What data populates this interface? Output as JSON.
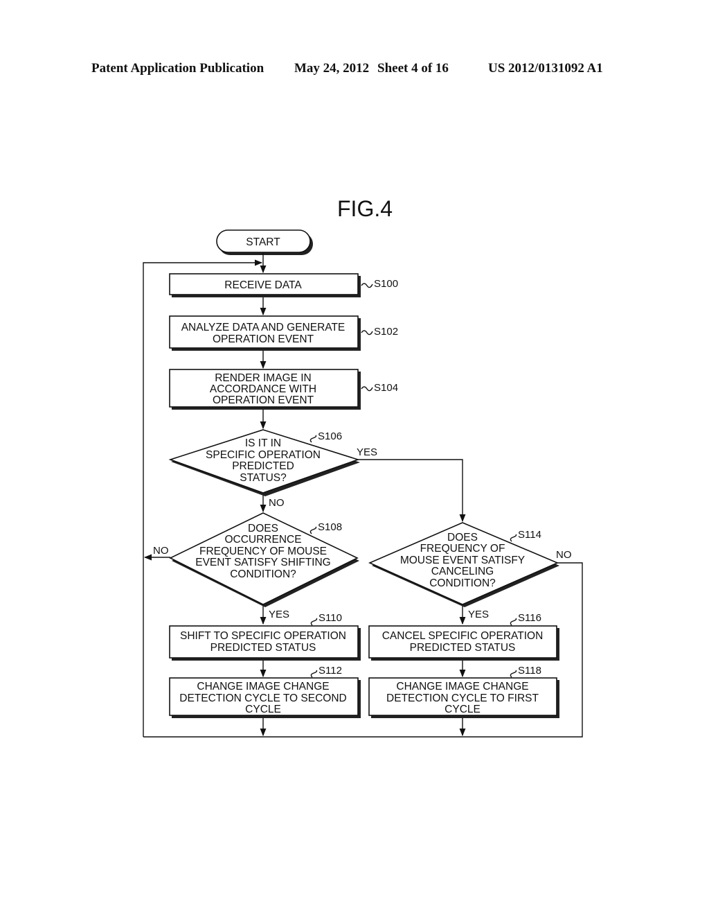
{
  "header": {
    "publication": "Patent Application Publication",
    "date": "May 24, 2012",
    "sheet": "Sheet 4 of 16",
    "number": "US 2012/0131092 A1"
  },
  "figure": {
    "title": "FIG.4",
    "start": "START",
    "steps": {
      "s100": {
        "id": "S100",
        "lines": [
          "RECEIVE DATA"
        ]
      },
      "s102": {
        "id": "S102",
        "lines": [
          "ANALYZE DATA AND GENERATE",
          "OPERATION EVENT"
        ]
      },
      "s104": {
        "id": "S104",
        "lines": [
          "RENDER IMAGE IN",
          "ACCORDANCE WITH",
          "OPERATION EVENT"
        ]
      },
      "s106": {
        "id": "S106",
        "lines": [
          "IS IT IN",
          "SPECIFIC OPERATION",
          "PREDICTED",
          "STATUS?"
        ]
      },
      "s108": {
        "id": "S108",
        "lines": [
          "DOES",
          "OCCURRENCE",
          "FREQUENCY OF MOUSE",
          "EVENT SATISFY SHIFTING",
          "CONDITION?"
        ]
      },
      "s110": {
        "id": "S110",
        "lines": [
          "SHIFT TO SPECIFIC OPERATION",
          "PREDICTED STATUS"
        ]
      },
      "s112": {
        "id": "S112",
        "lines": [
          "CHANGE IMAGE CHANGE",
          "DETECTION CYCLE TO SECOND",
          "CYCLE"
        ]
      },
      "s114": {
        "id": "S114",
        "lines": [
          "DOES",
          "FREQUENCY OF",
          "MOUSE EVENT SATISFY",
          "CANCELING",
          "CONDITION?"
        ]
      },
      "s116": {
        "id": "S116",
        "lines": [
          "CANCEL SPECIFIC OPERATION",
          "PREDICTED STATUS"
        ]
      },
      "s118": {
        "id": "S118",
        "lines": [
          "CHANGE IMAGE CHANGE",
          "DETECTION CYCLE TO FIRST",
          "CYCLE"
        ]
      }
    },
    "branch_labels": {
      "s106_yes": "YES",
      "s106_no": "NO",
      "s108_no": "NO",
      "s108_yes": "YES",
      "s114_no": "NO",
      "s114_yes": "YES"
    }
  }
}
